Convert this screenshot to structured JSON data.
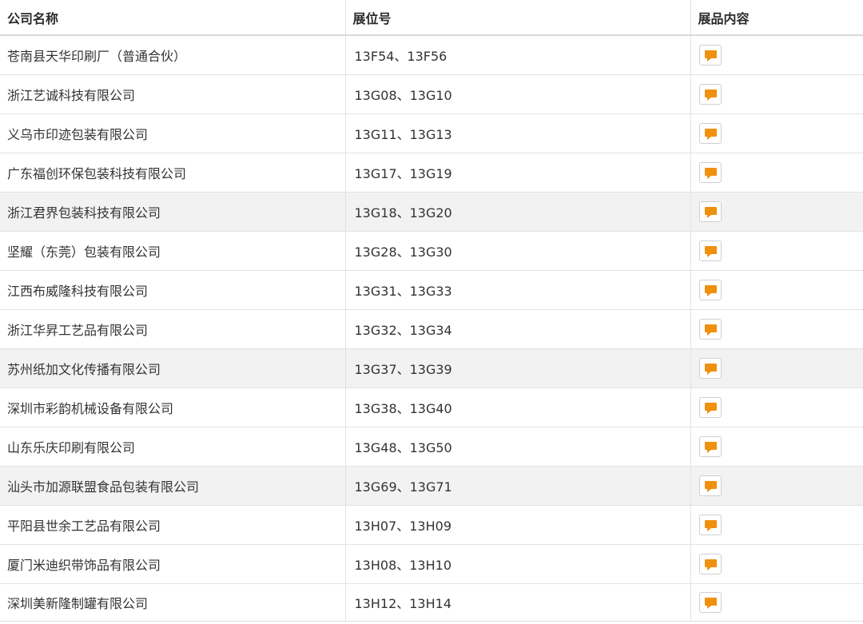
{
  "header": {
    "company": "公司名称",
    "booth": "展位号",
    "content": "展品内容"
  },
  "rows": [
    {
      "company": "苍南县天华印刷厂（普通合伙）",
      "booth": "13F54、13F56",
      "shaded": false
    },
    {
      "company": "浙江艺诚科技有限公司",
      "booth": "13G08、13G10",
      "shaded": false
    },
    {
      "company": "义乌市印迹包装有限公司",
      "booth": "13G11、13G13",
      "shaded": false
    },
    {
      "company": "广东福创环保包装科技有限公司",
      "booth": "13G17、13G19",
      "shaded": false
    },
    {
      "company": "浙江君界包装科技有限公司",
      "booth": "13G18、13G20",
      "shaded": true
    },
    {
      "company": "坚耀（东莞）包装有限公司",
      "booth": "13G28、13G30",
      "shaded": false
    },
    {
      "company": "江西布威隆科技有限公司",
      "booth": "13G31、13G33",
      "shaded": false
    },
    {
      "company": "浙江华昇工艺品有限公司",
      "booth": "13G32、13G34",
      "shaded": false
    },
    {
      "company": "苏州纸加文化传播有限公司",
      "booth": "13G37、13G39",
      "shaded": true
    },
    {
      "company": "深圳市彩韵机械设备有限公司",
      "booth": "13G38、13G40",
      "shaded": false
    },
    {
      "company": "山东乐庆印刷有限公司",
      "booth": "13G48、13G50",
      "shaded": false
    },
    {
      "company": "汕头市加源联盟食品包装有限公司",
      "booth": "13G69、13G71",
      "shaded": true
    },
    {
      "company": "平阳县世余工艺品有限公司",
      "booth": "13H07、13H09",
      "shaded": false
    },
    {
      "company": "厦门米迪织带饰品有限公司",
      "booth": "13H08、13H10",
      "shaded": false
    },
    {
      "company": "深圳美新隆制罐有限公司",
      "booth": "13H12、13H14",
      "shaded": false
    }
  ],
  "icons": {
    "content_button": "message-icon"
  },
  "colors": {
    "accent": "#f0900f",
    "row_shade": "#f2f2f2",
    "grid": "#e2e2e2"
  }
}
